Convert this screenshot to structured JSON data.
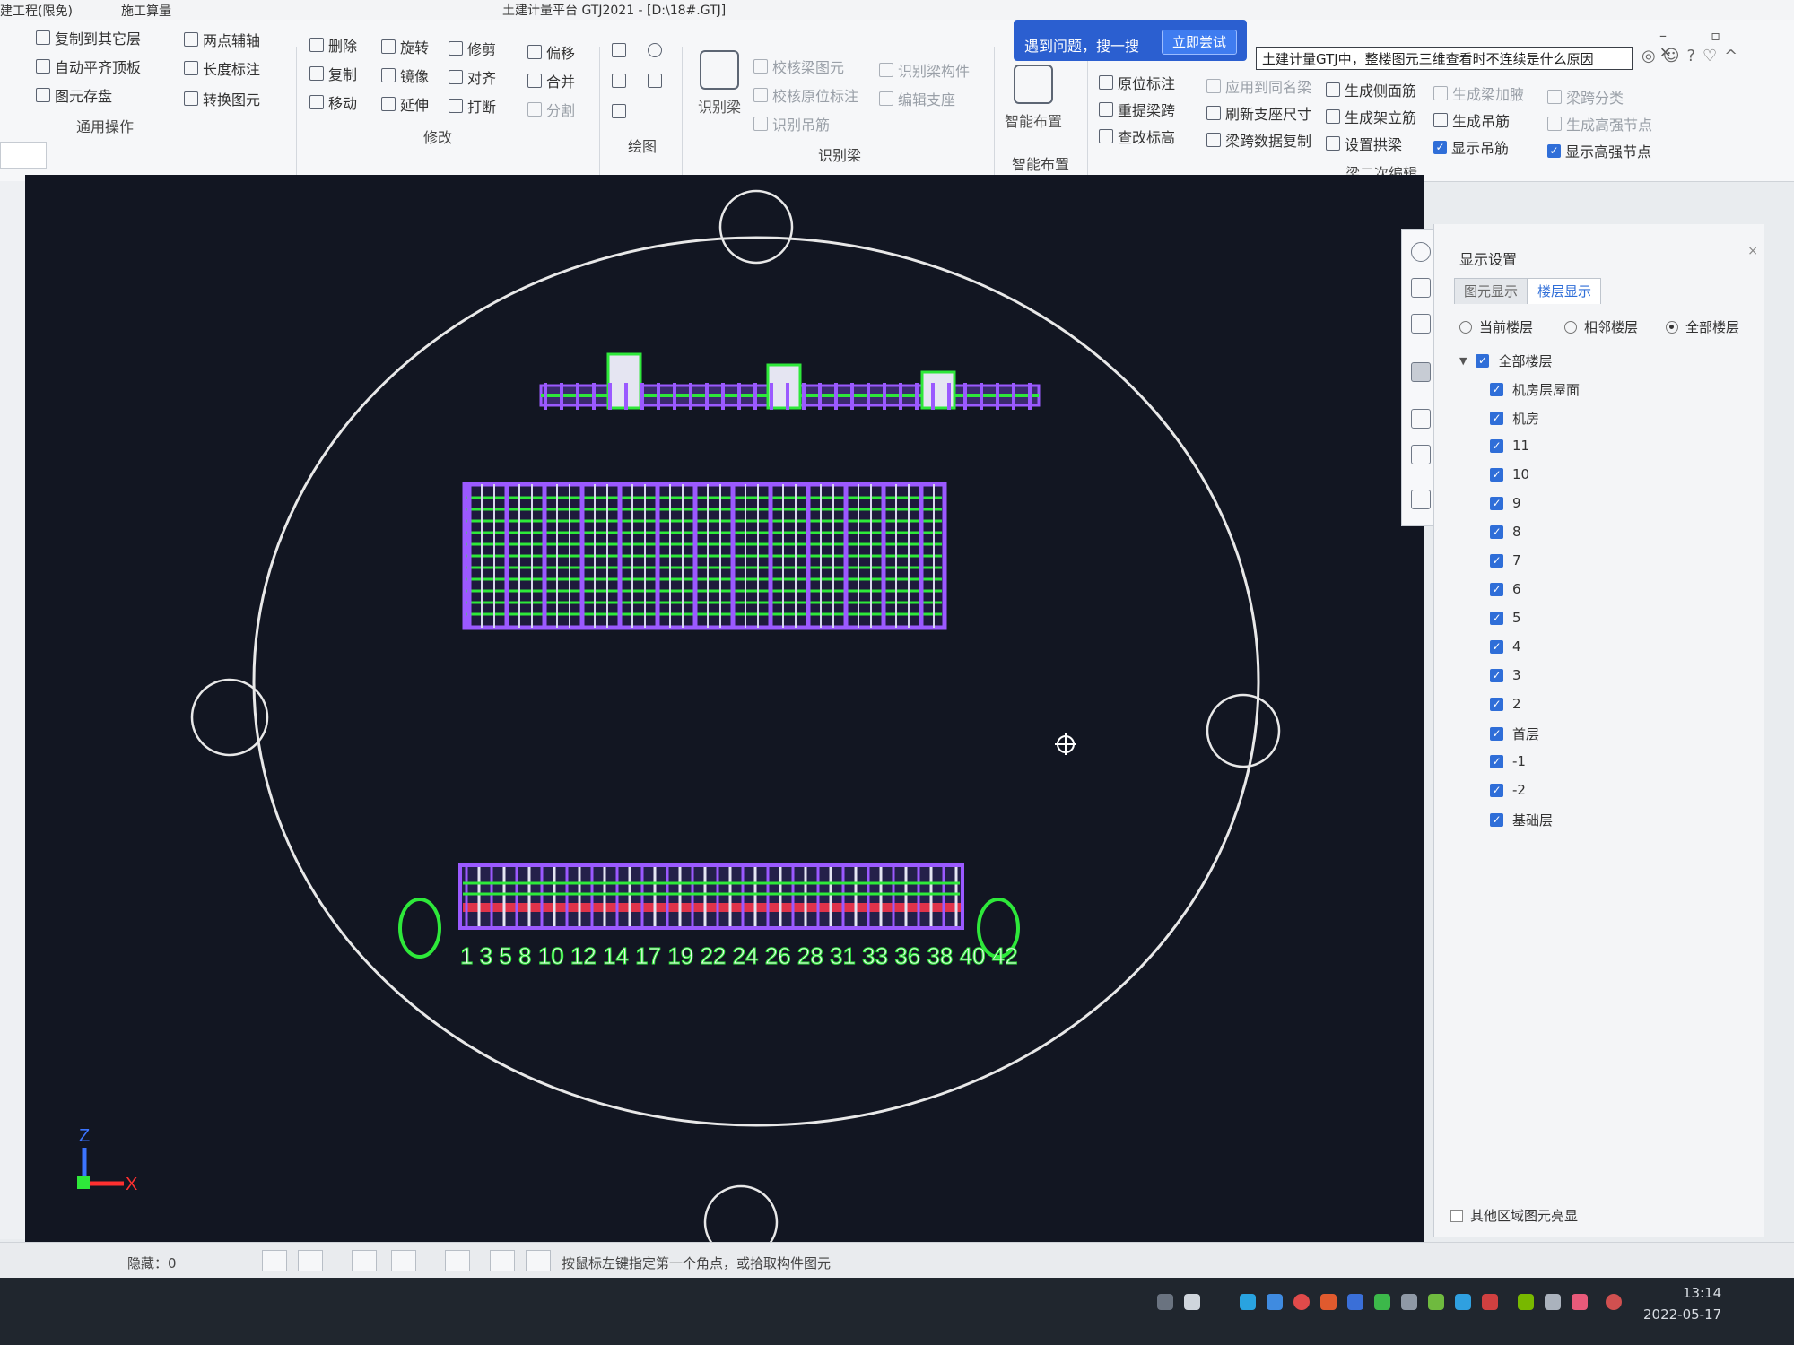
{
  "titlebar": {
    "tab1": "建工程(限免)",
    "tab2": "施工算量",
    "doc_title": "土建计量平台 GTJ2021 - [D:\\18#.GTJ]"
  },
  "ribbon": {
    "general": {
      "copy_to_other_floor": "复制到其它层",
      "auto_flat_top": "自动平齐顶板",
      "element_storage": "图元存盘",
      "two_point_axis": "两点辅轴",
      "length_mark": "长度标注",
      "convert_element": "转换图元",
      "group_label": "通用操作"
    },
    "modify": {
      "delete": "删除",
      "copy": "复制",
      "move": "移动",
      "rotate": "旋转",
      "mirror": "镜像",
      "extend": "延伸",
      "trim": "修剪",
      "align": "对齐",
      "break": "打断",
      "offset": "偏移",
      "merge": "合并",
      "split": "分割",
      "group_label": "修改"
    },
    "draw": {
      "group_label": "绘图"
    },
    "identify": {
      "big_button": "识别梁",
      "check_beam_element": "校核梁图元",
      "check_origin_mark": "校核原位标注",
      "identify_hanger_bar": "识别吊筋",
      "identify_beam_component": "识别梁构件",
      "edit_support": "编辑支座",
      "group_label": "识别梁"
    },
    "smart": {
      "big_button": "智能布置",
      "group_label": "智能布置"
    },
    "beam_edit": {
      "origin_mark": "原位标注",
      "reextract_span": "重提梁跨",
      "change_elevation": "查改标高",
      "apply_same_name": "应用到同名梁",
      "refresh_support_size": "刷新支座尺寸",
      "beam_span_copy": "梁跨数据复制",
      "gen_side_bar": "生成侧面筋",
      "gen_stirrup": "生成架立筋",
      "set_arch": "设置拱梁",
      "gen_haunch": "生成梁加腋",
      "gen_hanger": "生成吊筋",
      "show_hanger": "显示吊筋",
      "span_classify": "梁跨分类",
      "gen_high_strength_node": "生成高强节点",
      "show_high_strength_node": "显示高强节点",
      "group_label": "梁二次编辑"
    }
  },
  "promo": {
    "text": "遇到问题，搜一搜",
    "try_label": "立即尝试"
  },
  "search": {
    "value": "土建计量GTJ中，整楼图元三维查看时不连续是什么原因"
  },
  "panel": {
    "title": "显示设置",
    "tabs": [
      "图元显示",
      "楼层显示"
    ],
    "radios": [
      {
        "label": "当前楼层",
        "selected": false
      },
      {
        "label": "相邻楼层",
        "selected": false
      },
      {
        "label": "全部楼层",
        "selected": true
      }
    ],
    "floors_root": "全部楼层",
    "floors": [
      "机房层屋面",
      "机房",
      "11",
      "10",
      "9",
      "8",
      "7",
      "6",
      "5",
      "4",
      "3",
      "2",
      "首层",
      "-1",
      "-2",
      "基础层"
    ],
    "other_area": "其他区域图元亮显"
  },
  "canvas": {
    "axis_numbers": "1 3 5 8 10 12 14 17 19 22 24 26 28 31 33 36 38 40 42",
    "axis_z": "Z",
    "axis_x": "X",
    "colors": {
      "bg": "#121622",
      "purple": "#9b59ff",
      "green": "#2ee83a",
      "orbit": "#e8e8e8"
    }
  },
  "status": {
    "hidden": "隐藏：0",
    "hint": "按鼠标左键指定第一个角点，或拾取构件图元"
  },
  "taskbar": {
    "time": "13:14",
    "date": "2022-05-17"
  }
}
